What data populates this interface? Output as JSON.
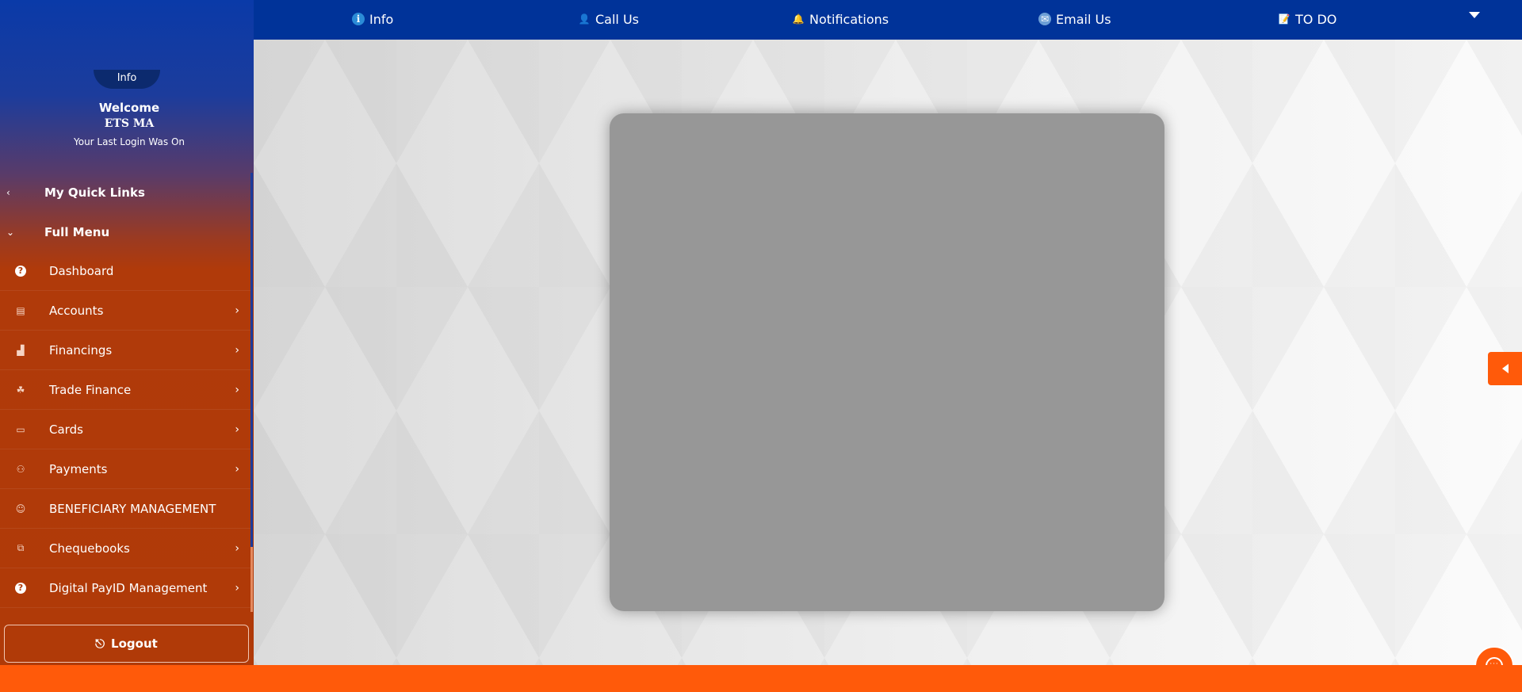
{
  "topnav": {
    "info": "Info",
    "call_us": "Call Us",
    "notifications": "Notifications",
    "email_us": "Email Us",
    "todo": "TO DO"
  },
  "profile": {
    "info_tab": "Info",
    "welcome": "Welcome",
    "username": "ETS MA",
    "last_login": "Your Last Login Was On"
  },
  "sidebar": {
    "quick_links": "My Quick Links",
    "full_menu": "Full Menu",
    "items": [
      {
        "label": "Dashboard",
        "icon": "help-circle-icon",
        "has_submenu": false
      },
      {
        "label": "Accounts",
        "icon": "wallet-icon",
        "has_submenu": true
      },
      {
        "label": "Financings",
        "icon": "bar-chart-icon",
        "has_submenu": true
      },
      {
        "label": "Trade Finance",
        "icon": "handshake-icon",
        "has_submenu": true
      },
      {
        "label": "Cards",
        "icon": "card-icon",
        "has_submenu": true
      },
      {
        "label": "Payments",
        "icon": "payment-icon",
        "has_submenu": true
      },
      {
        "label": "BENEFICIARY MANAGEMENT",
        "icon": "users-icon",
        "has_submenu": false
      },
      {
        "label": "Chequebooks",
        "icon": "chequebook-icon",
        "has_submenu": true
      },
      {
        "label": "Digital PayID Management",
        "icon": "help-circle-icon",
        "has_submenu": true
      }
    ],
    "logout": "Logout"
  },
  "colors": {
    "topbar": "#003399",
    "accent_orange": "#ff5a0a",
    "sidebar_rust": "#b03a08",
    "modal_gray": "#979797"
  }
}
